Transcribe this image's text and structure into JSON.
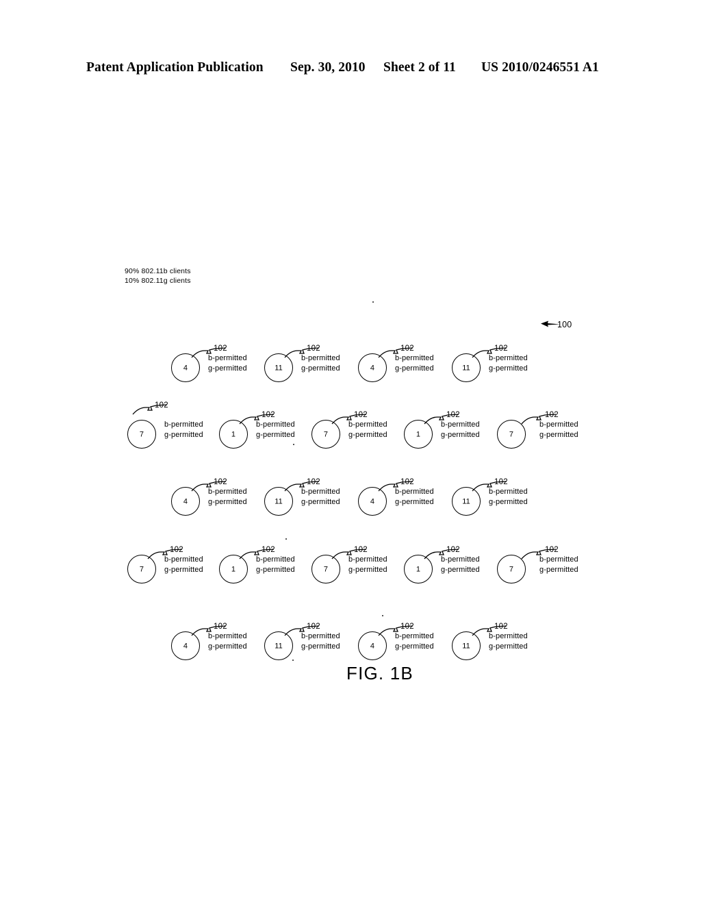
{
  "header": {
    "publication": "Patent Application Publication",
    "date": "Sep. 30, 2010",
    "sheet": "Sheet 2 of 11",
    "patent_number": "US 2010/0246551 A1"
  },
  "figure": {
    "caption": "FIG. 1B",
    "system_ref": "100",
    "client_mix_line1": "90% 802.11b clients",
    "client_mix_line2": "10% 802.11g clients",
    "cell_ref": "102",
    "perm_b": "b-permitted",
    "perm_g": "g-permitted",
    "rows": [
      {
        "index": 0,
        "offset": true,
        "cells": [
          {
            "channel": "4",
            "ref": "102",
            "b": "b-permitted",
            "g": "g-permitted"
          },
          {
            "channel": "11",
            "ref": "102",
            "b": "b-permitted",
            "g": "g-permitted"
          },
          {
            "channel": "4",
            "ref": "102",
            "b": "b-permitted",
            "g": "g-permitted"
          },
          {
            "channel": "11",
            "ref": "102",
            "b": "b-permitted",
            "g": "g-permitted"
          }
        ]
      },
      {
        "index": 1,
        "offset": false,
        "cells": [
          {
            "channel": "7",
            "ref": "102",
            "b": "b-permitted",
            "g": "g-permitted"
          },
          {
            "channel": "1",
            "ref": "102",
            "b": "b-permitted",
            "g": "g-permitted"
          },
          {
            "channel": "7",
            "ref": "102",
            "b": "b-permitted",
            "g": "g-permitted"
          },
          {
            "channel": "1",
            "ref": "102",
            "b": "b-permitted",
            "g": "g-permitted"
          },
          {
            "channel": "7",
            "ref": "102",
            "b": "b-permitted",
            "g": "g-permitted"
          }
        ]
      },
      {
        "index": 2,
        "offset": true,
        "cells": [
          {
            "channel": "4",
            "ref": "102",
            "b": "b-permitted",
            "g": "g-permitted"
          },
          {
            "channel": "11",
            "ref": "102",
            "b": "b-permitted",
            "g": "g-permitted"
          },
          {
            "channel": "4",
            "ref": "102",
            "b": "b-permitted",
            "g": "g-permitted"
          },
          {
            "channel": "11",
            "ref": "102",
            "b": "b-permitted",
            "g": "g-permitted"
          }
        ]
      },
      {
        "index": 3,
        "offset": false,
        "cells": [
          {
            "channel": "7",
            "ref": "102",
            "b": "b-permitted",
            "g": "g-permitted"
          },
          {
            "channel": "1",
            "ref": "102",
            "b": "b-permitted",
            "g": "g-permitted"
          },
          {
            "channel": "7",
            "ref": "102",
            "b": "b-permitted",
            "g": "g-permitted"
          },
          {
            "channel": "1",
            "ref": "102",
            "b": "b-permitted",
            "g": "g-permitted"
          },
          {
            "channel": "7",
            "ref": "102",
            "b": "b-permitted",
            "g": "g-permitted"
          }
        ]
      },
      {
        "index": 4,
        "offset": true,
        "cells": [
          {
            "channel": "4",
            "ref": "102",
            "b": "b-permitted",
            "g": "g-permitted"
          },
          {
            "channel": "11",
            "ref": "102",
            "b": "b-permitted",
            "g": "g-permitted"
          },
          {
            "channel": "4",
            "ref": "102",
            "b": "b-permitted",
            "g": "g-permitted"
          },
          {
            "channel": "11",
            "ref": "102",
            "b": "b-permitted",
            "g": "g-permitted"
          }
        ]
      }
    ]
  },
  "layout": {
    "row_tops": [
      503,
      600,
      698,
      797,
      909
    ],
    "col_x_offset": [
      250,
      386,
      523,
      660
    ],
    "col_x_flush": [
      186,
      320,
      455,
      590,
      726
    ]
  }
}
